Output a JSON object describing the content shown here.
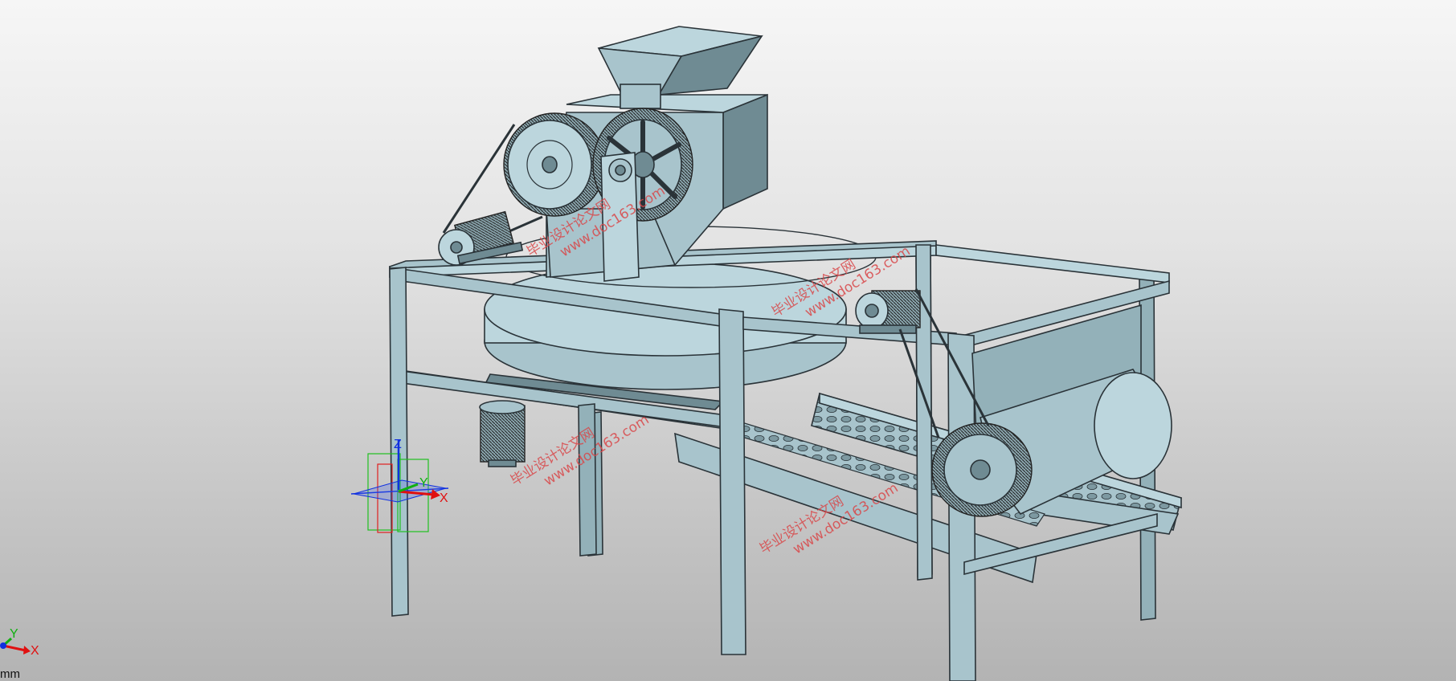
{
  "viewport": {
    "units": "mm"
  },
  "manipulator": {
    "x_label": "X",
    "y_label": "Y",
    "z_label": "Z"
  },
  "triad": {
    "x_label": "X",
    "y_label": "Y"
  },
  "watermarks": [
    {
      "line1": "毕业设计论文网",
      "line2": "www.doc163.com"
    },
    {
      "line1": "毕业设计论文网",
      "line2": "www.doc163.com"
    },
    {
      "line1": "毕业设计论文网",
      "line2": "www.doc163.com"
    },
    {
      "line1": "毕业设计论文网",
      "line2": "www.doc163.com"
    }
  ],
  "colors": {
    "model": "#a8c4cc",
    "background_top": "#f6f6f6",
    "background_bottom": "#b3b3b3",
    "axis_x": "#e01010",
    "axis_y": "#10b010",
    "axis_z": "#1030e0",
    "watermark": "#d9484a"
  }
}
